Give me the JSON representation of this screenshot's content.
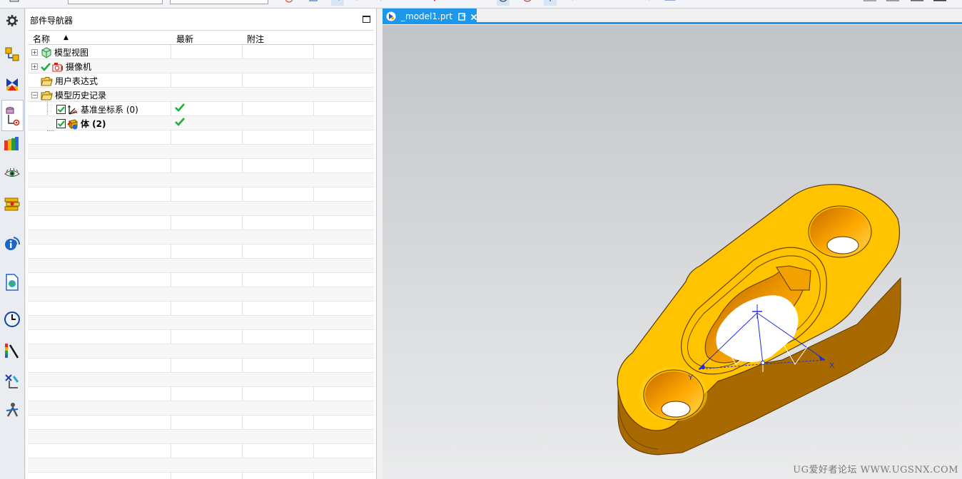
{
  "navigator": {
    "title": "部件导航器",
    "columns": [
      "名称",
      "最新",
      "附注"
    ],
    "sort_indicator": "▲",
    "rows": [
      {
        "label": "模型视图",
        "latest_check": false
      },
      {
        "label": "摄像机",
        "latest_check": false
      },
      {
        "label": "用户表达式",
        "latest_check": false
      },
      {
        "label": "模型历史记录",
        "latest_check": false
      },
      {
        "label": "基准坐标系 (0)",
        "latest_check": true
      },
      {
        "label": "体 (2)",
        "latest_check": true
      }
    ]
  },
  "tab": {
    "label": "_model1.prt"
  },
  "viewport": {
    "watermark": "UG爱好者论坛 WWW.UGSNX.COM",
    "axis_x_label": "X",
    "axis_y_label": "Y",
    "part_color": "#f5b800",
    "csys_color": "#1a2ee0"
  },
  "colors": {
    "accent": "#1c97ea",
    "check_green": "#1fae3b"
  }
}
